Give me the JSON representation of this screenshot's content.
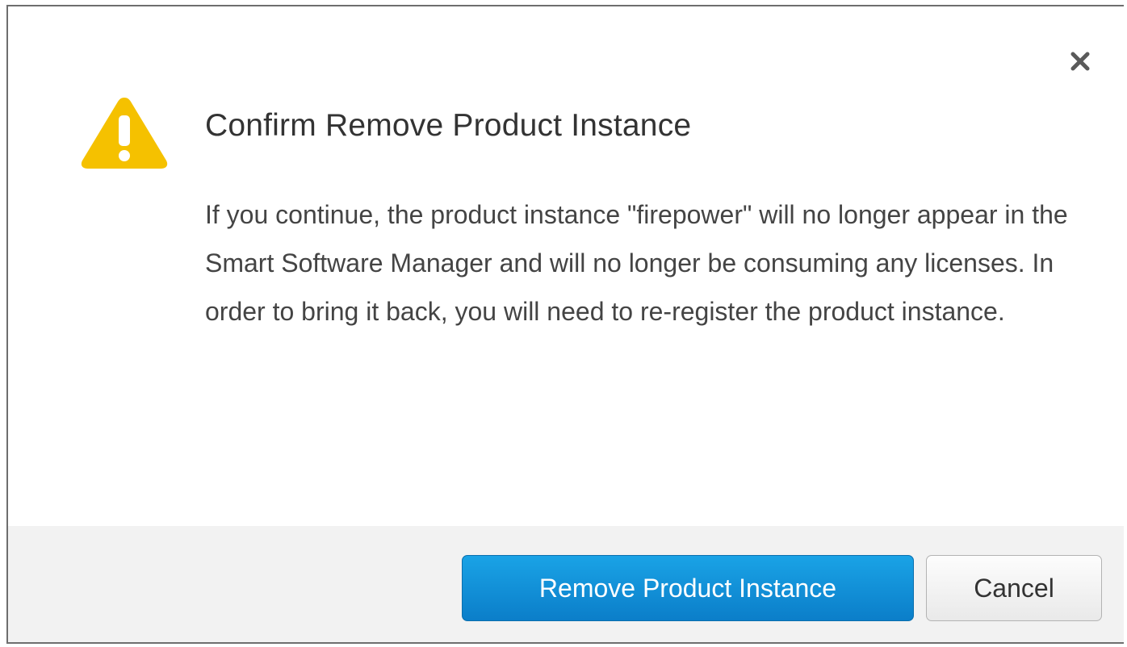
{
  "dialog": {
    "title": "Confirm Remove Product Instance",
    "message": "If you continue, the product instance \"firepower\" will no longer appear in the Smart Software Manager and will no longer be consuming any licenses. In order to bring it back, you will need to re-register the product instance.",
    "icons": {
      "warning": "warning-triangle-icon",
      "close": "close-icon"
    },
    "colors": {
      "warning": "#f5c100",
      "primary": "#0b8ad8",
      "footer": "#f2f2f2"
    }
  },
  "actions": {
    "remove_label": "Remove Product Instance",
    "cancel_label": "Cancel"
  }
}
